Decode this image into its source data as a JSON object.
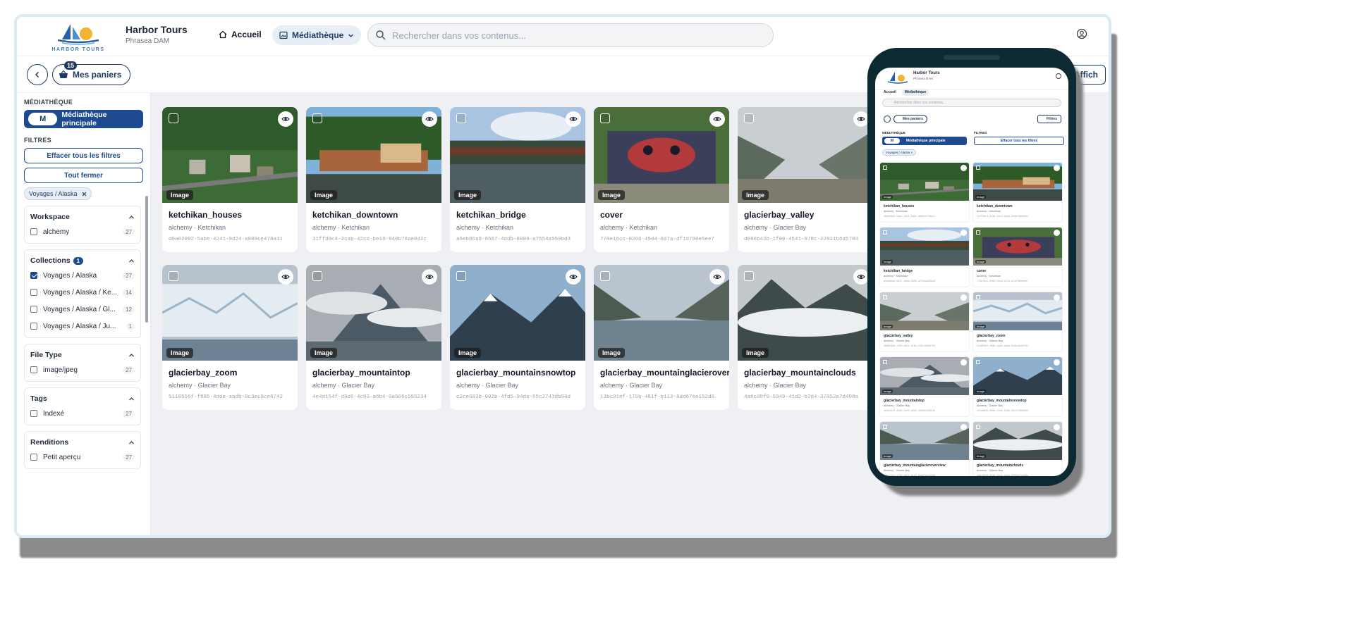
{
  "app": {
    "title": "Harbor Tours",
    "subtitle": "Phrasea DAM",
    "logo_text": "HARBOR TOURS"
  },
  "nav": {
    "home_label": "Accueil",
    "media_label": "Médiathèque",
    "search_placeholder": "Rechercher dans vos contenus..."
  },
  "toolbar": {
    "basket_label": "Mes paniers",
    "basket_count": "15",
    "display_label": "Affich"
  },
  "sidebar": {
    "library_label": "MÉDIATHÈQUE",
    "library_pill": "M",
    "library_name": "Médiathèque principale",
    "filters_label": "FILTRES",
    "clear_filters": "Effacer tous les filtres",
    "close_all": "Tout fermer",
    "active_chip": "Voyages / Alaska",
    "facets": [
      {
        "title": "Workspace",
        "badge": "",
        "rows": [
          {
            "label": "alchemy",
            "count": "27",
            "checked": false
          }
        ]
      },
      {
        "title": "Collections",
        "badge": "1",
        "rows": [
          {
            "label": "Voyages / Alaska",
            "count": "27",
            "checked": true
          },
          {
            "label": "Voyages / Alaska / Ke...",
            "count": "14",
            "checked": false
          },
          {
            "label": "Voyages / Alaska / Gl...",
            "count": "12",
            "checked": false
          },
          {
            "label": "Voyages / Alaska / Ju...",
            "count": "1",
            "checked": false
          }
        ]
      },
      {
        "title": "File Type",
        "badge": "",
        "rows": [
          {
            "label": "image/jpeg",
            "count": "27",
            "checked": false
          }
        ]
      },
      {
        "title": "Tags",
        "badge": "",
        "rows": [
          {
            "label": "Indexé",
            "count": "27",
            "checked": false
          }
        ]
      },
      {
        "title": "Renditions",
        "badge": "",
        "rows": [
          {
            "label": "Petit aperçu",
            "count": "27",
            "checked": false
          }
        ]
      }
    ]
  },
  "assets": [
    {
      "title": "ketchikan_houses",
      "workspace": "alchemy",
      "collection": "Ketchikan",
      "id": "d0a02092-5abe-4241-9d24-a809ce478a11",
      "type": "Image",
      "theme": "forest"
    },
    {
      "title": "ketchikan_downtown",
      "workspace": "alchemy",
      "collection": "Ketchikan",
      "id": "31ffd0c4-2cab-42cd-be19-940b78ae042c",
      "type": "Image",
      "theme": "harbor"
    },
    {
      "title": "ketchikan_bridge",
      "workspace": "alchemy",
      "collection": "Ketchikan",
      "id": "a5eb86a8-8587-4ddb-8809-a7554a959bd3",
      "type": "Image",
      "theme": "bridge"
    },
    {
      "title": "cover",
      "workspace": "alchemy",
      "collection": "Ketchikan",
      "id": "770e16cc-0260-49d4-947a-df1d780e5ee7",
      "type": "Image",
      "theme": "totem"
    },
    {
      "title": "glacierbay_valley",
      "workspace": "alchemy",
      "collection": "Glacier Bay",
      "id": "d096b43b-1f00-4541-978c-22911b6d5783",
      "type": "Image",
      "theme": "valley"
    },
    {
      "title": "glacierbay_zoom",
      "workspace": "alchemy",
      "collection": "Glacier Bay",
      "id": "5110556f-f885-4dde-aadb-0c3ec9ce8742",
      "type": "Image",
      "theme": "ice"
    },
    {
      "title": "glacierbay_mountaintop",
      "workspace": "alchemy",
      "collection": "Glacier Bay",
      "id": "4e4d154f-d9d6-4c03-a6b4-0a566c595234",
      "type": "Image",
      "theme": "cloudy"
    },
    {
      "title": "glacierbay_mountainsnowtop",
      "workspace": "alchemy",
      "collection": "Glacier Bay",
      "id": "c2ce683b-002b-4fd5-94da-65c2743db90d",
      "type": "Image",
      "theme": "snowtop"
    },
    {
      "title": "glacierbay_mountainglacieroverview",
      "workspace": "alchemy",
      "collection": "Glacier Bay",
      "id": "13bc91ef-175b-481f-b113-8dd67ee152d9",
      "type": "Image",
      "theme": "fjord"
    },
    {
      "title": "glacierbay_mountainclouds",
      "workspace": "alchemy",
      "collection": "Glacier Bay",
      "id": "4a6c09f0-5949-41d2-b2d4-37052e7d408a",
      "type": "Image",
      "theme": "clouds"
    }
  ],
  "mobile": {
    "filters_button": "Filtres",
    "library_label": "MÉDIATHÈQUE",
    "filters_label": "FILTRES"
  },
  "colors": {
    "primary": "#1e4a8f",
    "frame": "#d8ecf3",
    "phone": "#0d2a33"
  }
}
